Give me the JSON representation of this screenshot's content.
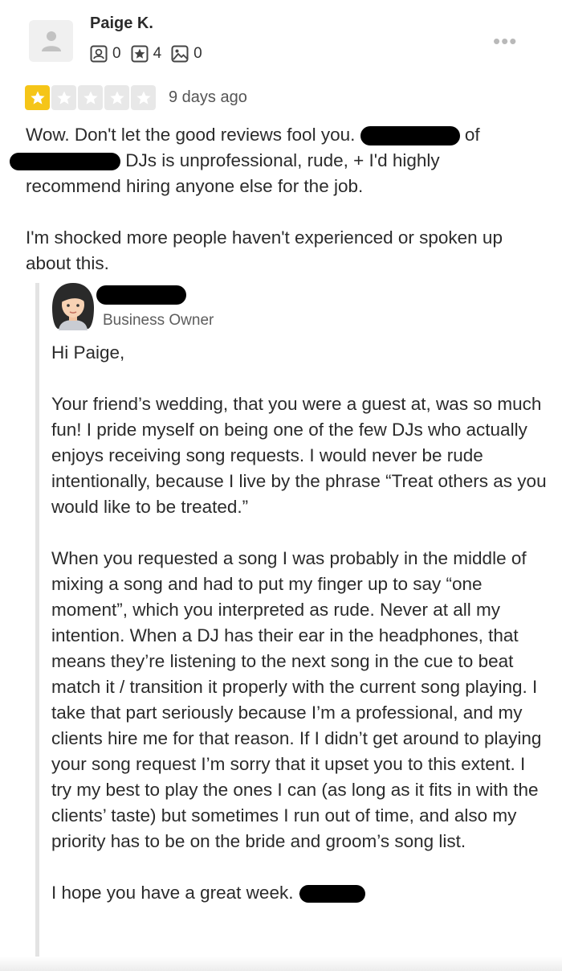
{
  "review": {
    "reviewer_name": "Paige K.",
    "stats": {
      "friends": "0",
      "reviews": "4",
      "photos": "0"
    },
    "rating": 1,
    "rating_max": 5,
    "date": "9 days ago",
    "line1_a": "Wow. Don't let the good reviews fool you. ",
    "line1_b": "of",
    "line2_a": " DJs is unprofessional, rude, + I'd highly recommend hiring anyone else for the job.",
    "paragraph2": "I'm shocked more people haven't experienced or spoken up about this."
  },
  "owner_reply": {
    "role": "Business Owner",
    "greeting": "Hi Paige,",
    "paragraph1": "Your friend’s wedding, that you were a guest at, was so much fun! I pride myself on being one of the few DJs who actually enjoys receiving song requests. I would never be rude intentionally, because I live by the phrase “Treat others as you would like to be treated.”",
    "paragraph2": "When you requested a song I was probably in the middle of mixing a song and had to put my finger up to say “one moment”, which you interpreted as rude. Never at all my intention. When a DJ has their ear in the headphones, that means they’re listening to the next song in the cue to beat match it / transition it properly with the current song playing. I take that part seriously because I’m a professional, and my clients hire me for that reason. If I didn’t get around to playing your song request I’m sorry that it upset you to this extent. I try my best to play the ones I can (as long as it fits in with the clients’ taste)  but sometimes I run out of time, and also my priority has to be on the bride and groom’s song list.",
    "closing": "I hope you have a great week. -"
  },
  "icons": {
    "menu": "more-horizontal-icon",
    "friends": "friends-icon",
    "reviews": "star-badge-icon",
    "photos": "photo-icon",
    "star": "star-icon",
    "owner_avatar": "woman-avatar-icon"
  },
  "colors": {
    "star_filled": "#f5c518",
    "star_empty": "#e8e8e8",
    "text": "#2b2b2b",
    "reply_rule": "#e3e3e3"
  }
}
